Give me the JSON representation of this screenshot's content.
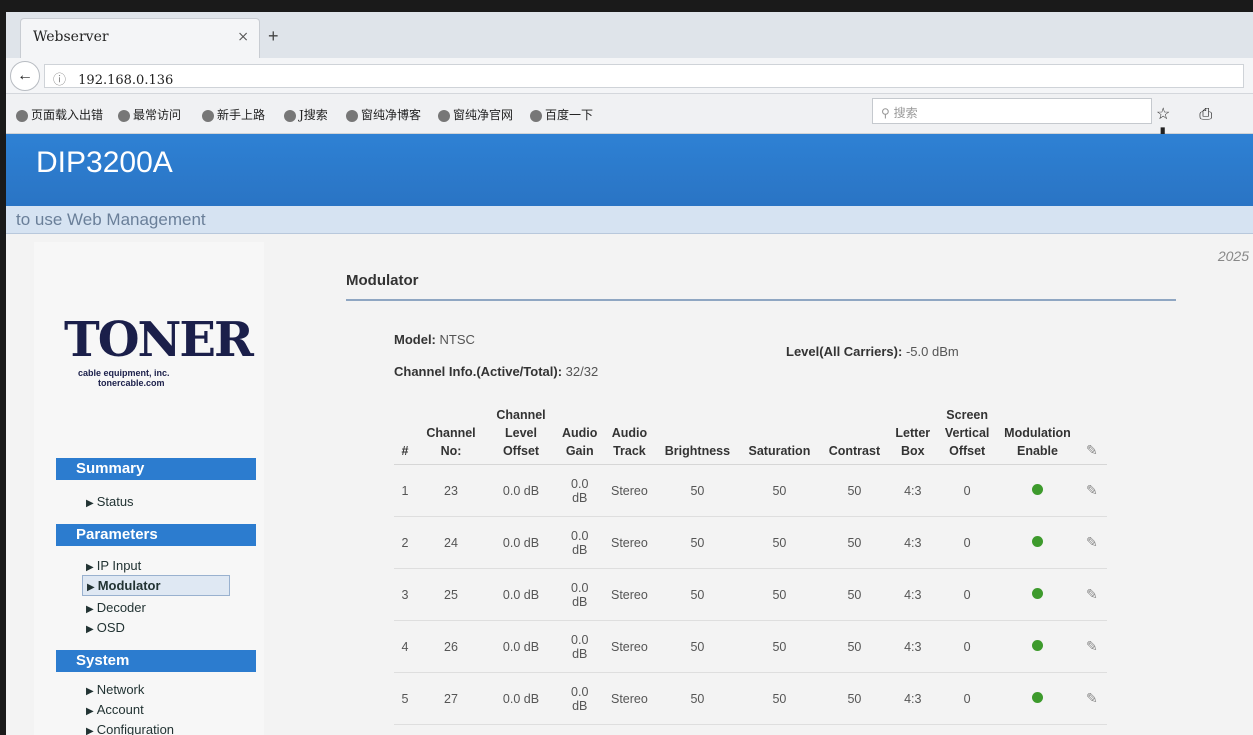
{
  "browser": {
    "tab_title": "Webserver",
    "tab_close": "×",
    "new_tab": "+",
    "url_info": "ⓘ",
    "url": "192.168.0.136",
    "bookmarks": [
      "页面载入出错",
      "最常访问",
      "新手上路",
      "J搜索",
      "窗纯净博客",
      "窗纯净官网",
      "百度一下"
    ],
    "search_placeholder": "搜索",
    "toolbar_icons": "☆ ⎙ ⬇"
  },
  "header": {
    "title": "DIP3200A",
    "subtitle": "to use Web Management"
  },
  "year": "2025",
  "logo": {
    "word": "TONER",
    "line1": "cable equipment, inc.",
    "line2": "tonercable.com"
  },
  "sidebar": {
    "summary": {
      "title": "Summary",
      "items": [
        "Status"
      ]
    },
    "parameters": {
      "title": "Parameters",
      "items": [
        "IP Input",
        "Modulator",
        "Decoder",
        "OSD"
      ]
    },
    "system": {
      "title": "System",
      "items": [
        "Network",
        "Account",
        "Configuration"
      ]
    }
  },
  "modulator": {
    "title": "Modulator",
    "model_label": "Model:",
    "model_value": "NTSC",
    "level_label": "Level(All Carriers):",
    "level_value": "-5.0 dBm",
    "channel_info_label": "Channel Info.(Active/Total):",
    "channel_info_value": "32/32"
  },
  "table": {
    "headers": [
      "#",
      "Channel No:",
      "Channel Level Offset",
      "Audio Gain",
      "Audio Track",
      "Brightness",
      "Saturation",
      "Contrast",
      "Letter Box",
      "Screen Vertical Offset",
      "Modulation Enable"
    ],
    "rows": [
      {
        "n": "1",
        "ch": "23",
        "offset": "0.0 dB",
        "gain": "0.0 dB",
        "track": "Stereo",
        "bright": "50",
        "sat": "50",
        "con": "50",
        "letter": "4:3",
        "svo": "0",
        "enabled": true
      },
      {
        "n": "2",
        "ch": "24",
        "offset": "0.0 dB",
        "gain": "0.0 dB",
        "track": "Stereo",
        "bright": "50",
        "sat": "50",
        "con": "50",
        "letter": "4:3",
        "svo": "0",
        "enabled": true
      },
      {
        "n": "3",
        "ch": "25",
        "offset": "0.0 dB",
        "gain": "0.0 dB",
        "track": "Stereo",
        "bright": "50",
        "sat": "50",
        "con": "50",
        "letter": "4:3",
        "svo": "0",
        "enabled": true
      },
      {
        "n": "4",
        "ch": "26",
        "offset": "0.0 dB",
        "gain": "0.0 dB",
        "track": "Stereo",
        "bright": "50",
        "sat": "50",
        "con": "50",
        "letter": "4:3",
        "svo": "0",
        "enabled": true
      },
      {
        "n": "5",
        "ch": "27",
        "offset": "0.0 dB",
        "gain": "0.0 dB",
        "track": "Stereo",
        "bright": "50",
        "sat": "50",
        "con": "50",
        "letter": "4:3",
        "svo": "0",
        "enabled": true
      }
    ]
  },
  "colors": {
    "accent": "#2c7ccf",
    "enabled_dot": "#3d9a2c"
  },
  "icons": {
    "edit": "pencil-icon",
    "status": "green-dot-icon"
  }
}
